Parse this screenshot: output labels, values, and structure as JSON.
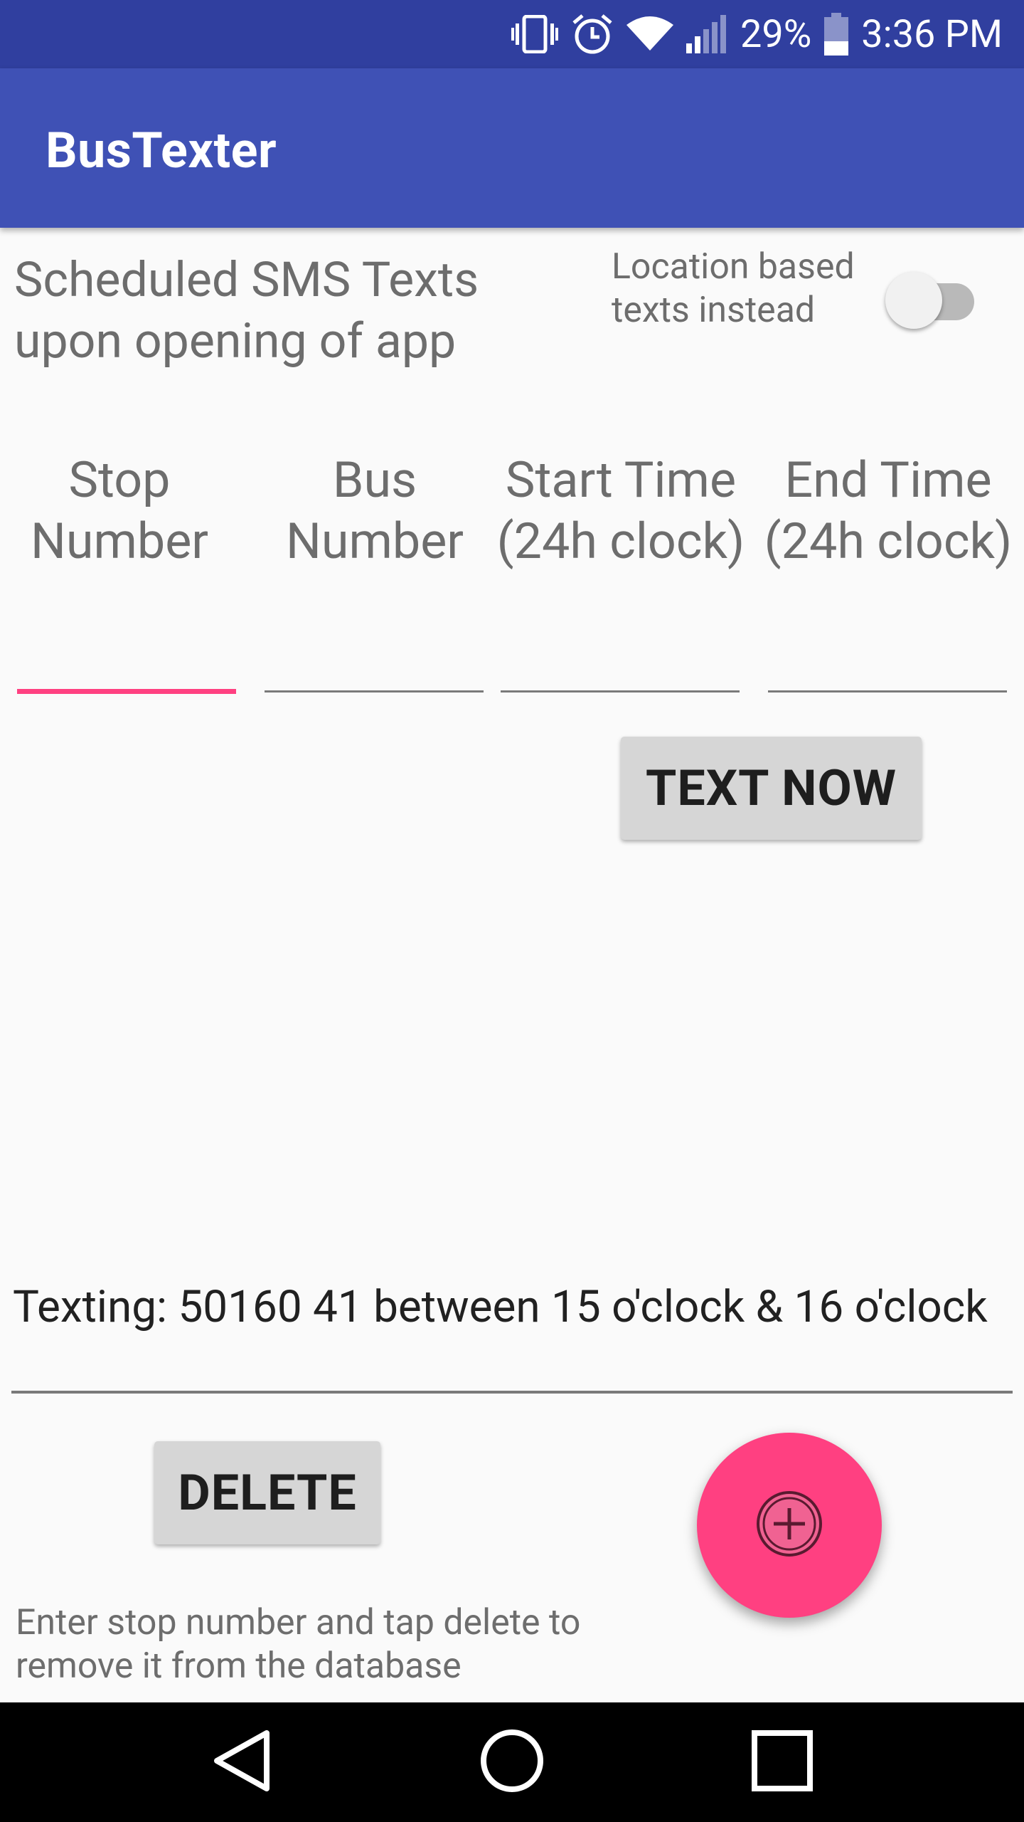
{
  "status_bar": {
    "icons": [
      "vibrate-icon",
      "alarm-icon",
      "wifi-icon",
      "signal-icon",
      "battery-icon"
    ],
    "battery": "29%",
    "time": "3:36 PM"
  },
  "app_bar": {
    "title": "BusTexter"
  },
  "main": {
    "scheduled_label": "Scheduled SMS Texts upon opening of app",
    "location_label": "Location based texts instead",
    "location_toggle_on": false,
    "columns": [
      {
        "line1": "Stop",
        "line2": "Number",
        "value": ""
      },
      {
        "line1": "Bus",
        "line2": "Number",
        "value": ""
      },
      {
        "line1": "Start Time",
        "line2": "(24h clock)",
        "value": ""
      },
      {
        "line1": "End Time",
        "line2": "(24h clock)",
        "value": ""
      }
    ],
    "text_now_label": "TEXT NOW",
    "texting_status": "Texting: 50160 41 between 15 o'clock & 16 o'clock",
    "delete_label": "DELETE",
    "helper_text": "Enter stop number and tap delete to remove it from the database",
    "fab_icon": "add-circle-icon"
  },
  "nav_bar": {
    "icons": [
      "back-icon",
      "home-icon",
      "recents-icon"
    ]
  },
  "colors": {
    "status_bar": "#303f9f",
    "app_bar": "#3f51b5",
    "accent": "#ff4081",
    "background": "#fafafa"
  }
}
